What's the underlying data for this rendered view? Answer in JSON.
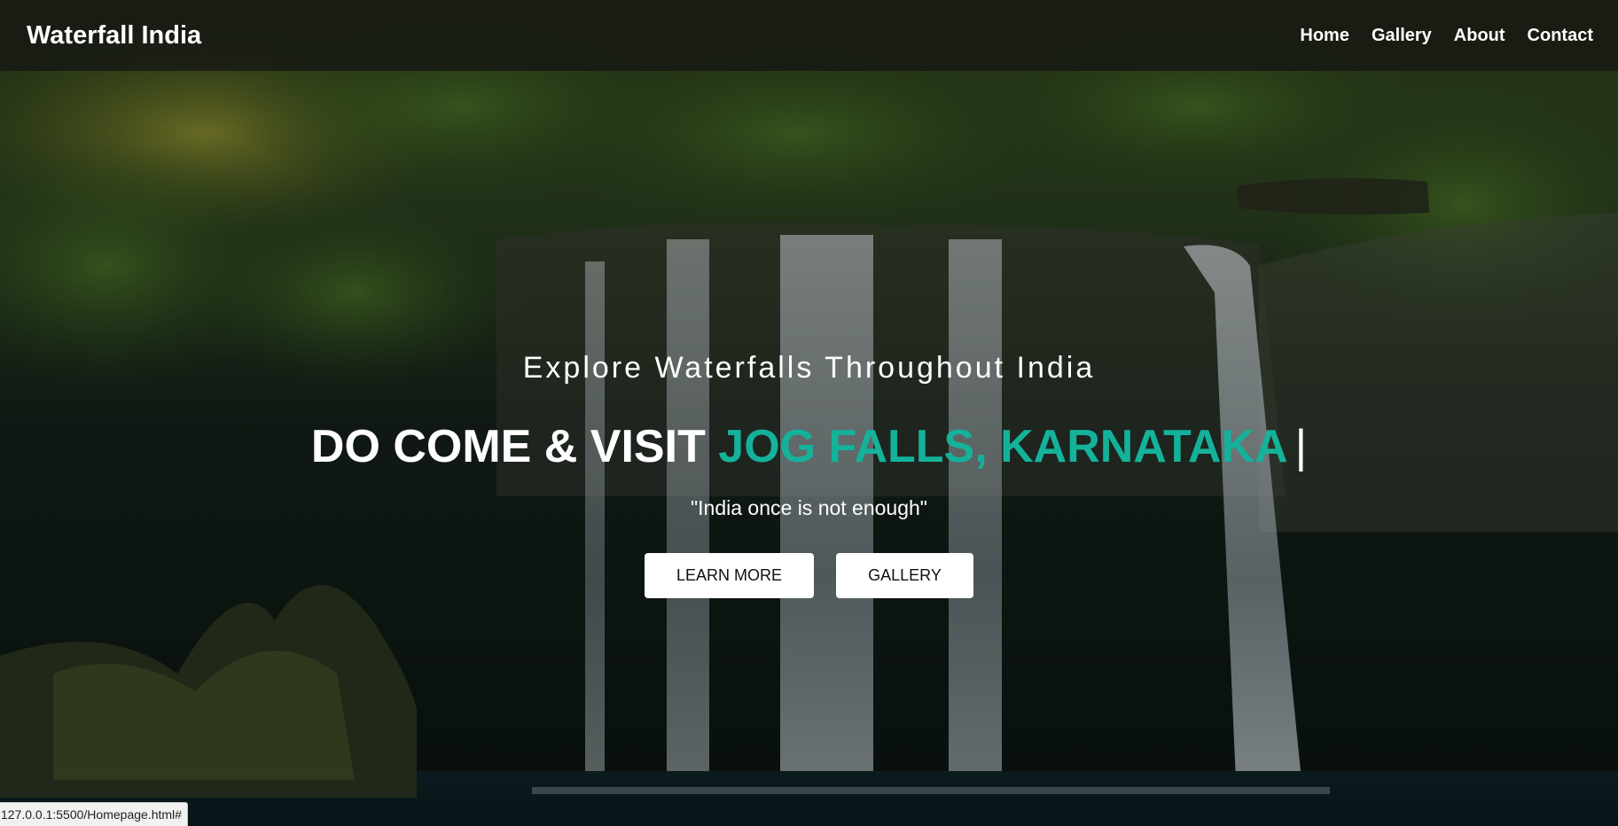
{
  "navbar": {
    "brand": "Waterfall India",
    "links": [
      "Home",
      "Gallery",
      "About",
      "Contact"
    ]
  },
  "hero": {
    "tagline": "Explore Waterfalls Throughout India",
    "headline_prefix": "DO COME & VISIT",
    "headline_highlight": "JOG FALLS, KARNATAKA",
    "cursor": "|",
    "quote": "\"India once is not enough\"",
    "buttons": {
      "learn_more": "LEARN MORE",
      "gallery": "GALLERY"
    }
  },
  "status_bar": {
    "url": "127.0.0.1:5500/Homepage.html#"
  },
  "colors": {
    "accent": "#14b29a",
    "navbar_bg": "#141414",
    "button_bg": "#ffffff"
  },
  "icons": {
    "background": "waterfall-forest-background"
  }
}
